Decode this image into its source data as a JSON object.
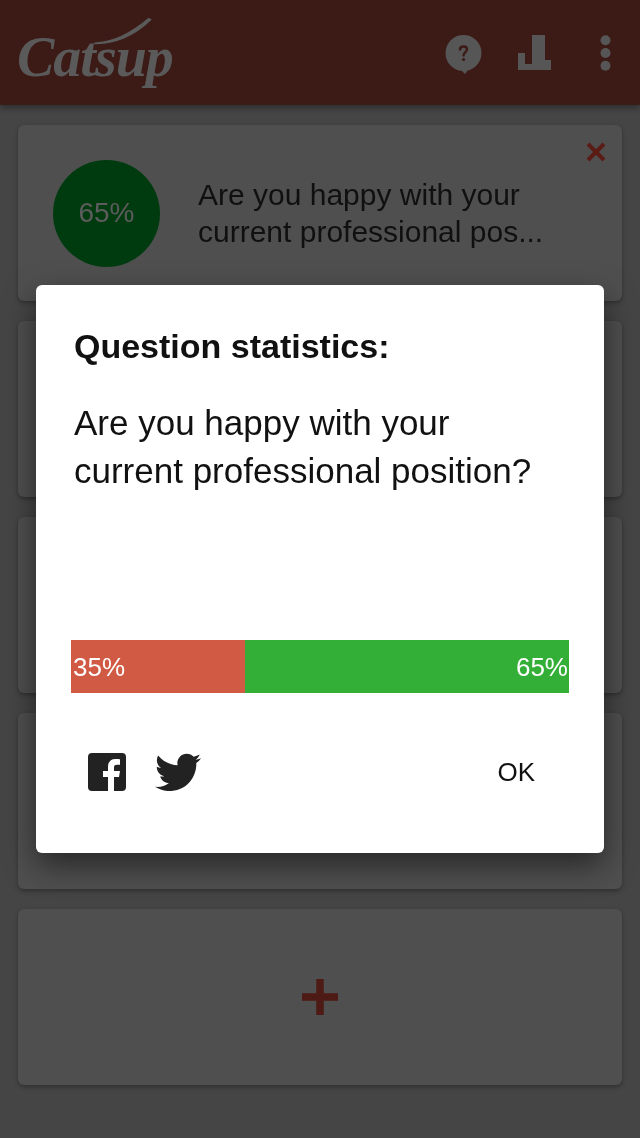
{
  "app_bar": {
    "logo": "Catsup"
  },
  "cards": [
    {
      "kind": "question",
      "score": "65%",
      "text": "Are you happy with your current professional pos..."
    },
    {
      "kind": "covered"
    },
    {
      "kind": "covered"
    },
    {
      "kind": "covered"
    },
    {
      "kind": "add"
    }
  ],
  "dialog": {
    "title": "Question statistics:",
    "question": "Are you happy with your current professional position?",
    "result_bar": {
      "level": 0.35,
      "left_label": "35%",
      "right_label": "65%"
    },
    "buttons": [
      "OK"
    ]
  }
}
